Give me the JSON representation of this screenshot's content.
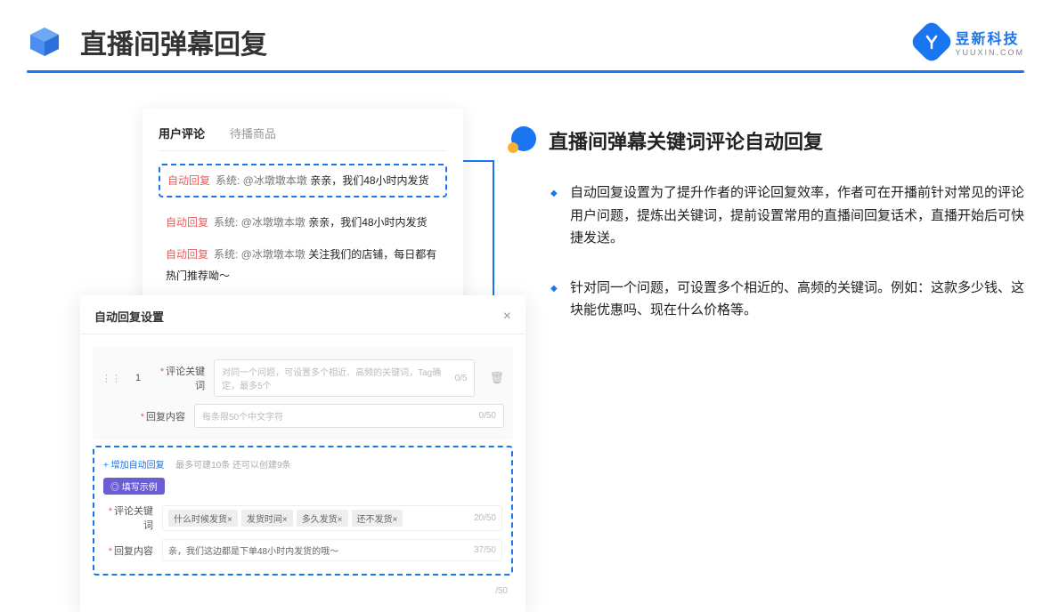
{
  "page_title": "直播间弹幕回复",
  "brand": {
    "cn": "昱新科技",
    "en": "YUUXIN.COM"
  },
  "comments_card": {
    "tabs": [
      "用户评论",
      "待播商品"
    ],
    "items": [
      {
        "tag": "自动回复",
        "sys": "系统: @冰墩墩本墩 ",
        "msg": "亲亲，我们48小时内发货"
      },
      {
        "tag": "自动回复",
        "sys": "系统: @冰墩墩本墩 ",
        "msg": "亲亲，我们48小时内发货"
      },
      {
        "tag": "自动回复",
        "sys": "系统: @冰墩墩本墩 ",
        "msg": "关注我们的店铺，每日都有热门推荐呦～"
      }
    ]
  },
  "settings_card": {
    "title": "自动回复设置",
    "index": "1",
    "kw_label": "评论关键词",
    "kw_placeholder": "对同一个问题，可设置多个相近、高频的关键词，Tag确定，最多5个",
    "kw_count": "0/5",
    "reply_label": "回复内容",
    "reply_placeholder": "每条限50个中文字符",
    "reply_count": "0/50",
    "add_link": "+ 增加自动回复",
    "add_hint": "最多可建10条 还可以创建9条",
    "example_badge": "◎ 填写示例",
    "ex_kw_label": "评论关键词",
    "ex_tags": [
      "什么时候发货×",
      "发货时间×",
      "多久发货×",
      "还不发货×"
    ],
    "ex_kw_count": "20/50",
    "ex_reply_label": "回复内容",
    "ex_reply_value": "亲，我们这边都是下单48小时内发货的哦～",
    "ex_reply_count": "37/50",
    "footer_count": "/50"
  },
  "right": {
    "title": "直播间弹幕关键词评论自动回复",
    "bullets": [
      "自动回复设置为了提升作者的评论回复效率，作者可在开播前针对常见的评论用户问题，提炼出关键词，提前设置常用的直播间回复话术，直播开始后可快捷发送。",
      "针对同一个问题，可设置多个相近的、高频的关键词。例如：这款多少钱、这块能优惠吗、现在什么价格等。"
    ]
  }
}
